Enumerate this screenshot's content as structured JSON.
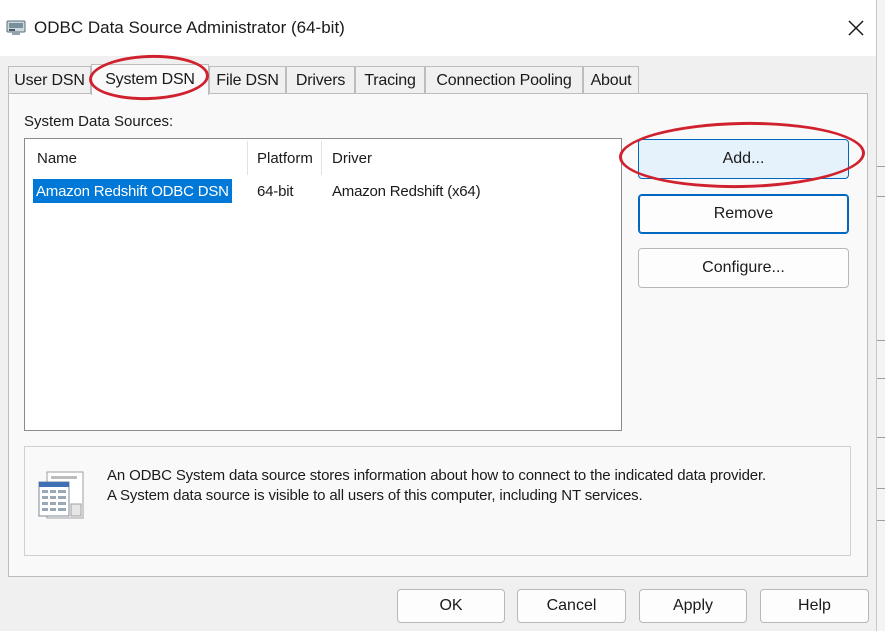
{
  "window": {
    "title": "ODBC Data Source Administrator (64-bit)",
    "close_glyph": "✕"
  },
  "tabs": [
    {
      "label": "User DSN",
      "active": false
    },
    {
      "label": "System DSN",
      "active": true
    },
    {
      "label": "File DSN",
      "active": false
    },
    {
      "label": "Drivers",
      "active": false
    },
    {
      "label": "Tracing",
      "active": false
    },
    {
      "label": "Connection Pooling",
      "active": false
    },
    {
      "label": "About",
      "active": false
    }
  ],
  "system_dsn": {
    "group_label": "System Data Sources:",
    "columns": [
      "Name",
      "Platform",
      "Driver"
    ],
    "rows": [
      {
        "name": "Amazon Redshift ODBC DSN",
        "platform": "64-bit",
        "driver": "Amazon Redshift (x64)",
        "selected": true
      }
    ],
    "buttons": {
      "add": "Add...",
      "remove": "Remove",
      "configure": "Configure..."
    },
    "info_lines": [
      "An ODBC System data source stores information about how to connect to the indicated data provider.",
      "A System data source is visible to all users of this computer, including NT services."
    ]
  },
  "footer": {
    "ok": "OK",
    "cancel": "Cancel",
    "apply": "Apply",
    "help": "Help"
  },
  "icons": {
    "app": "odbc-admin-icon",
    "close": "close-icon",
    "info": "data-source-document-icon"
  },
  "colors": {
    "selection": "#0078d7",
    "focus_border": "#0067c0",
    "annotation": "#d0222e"
  }
}
